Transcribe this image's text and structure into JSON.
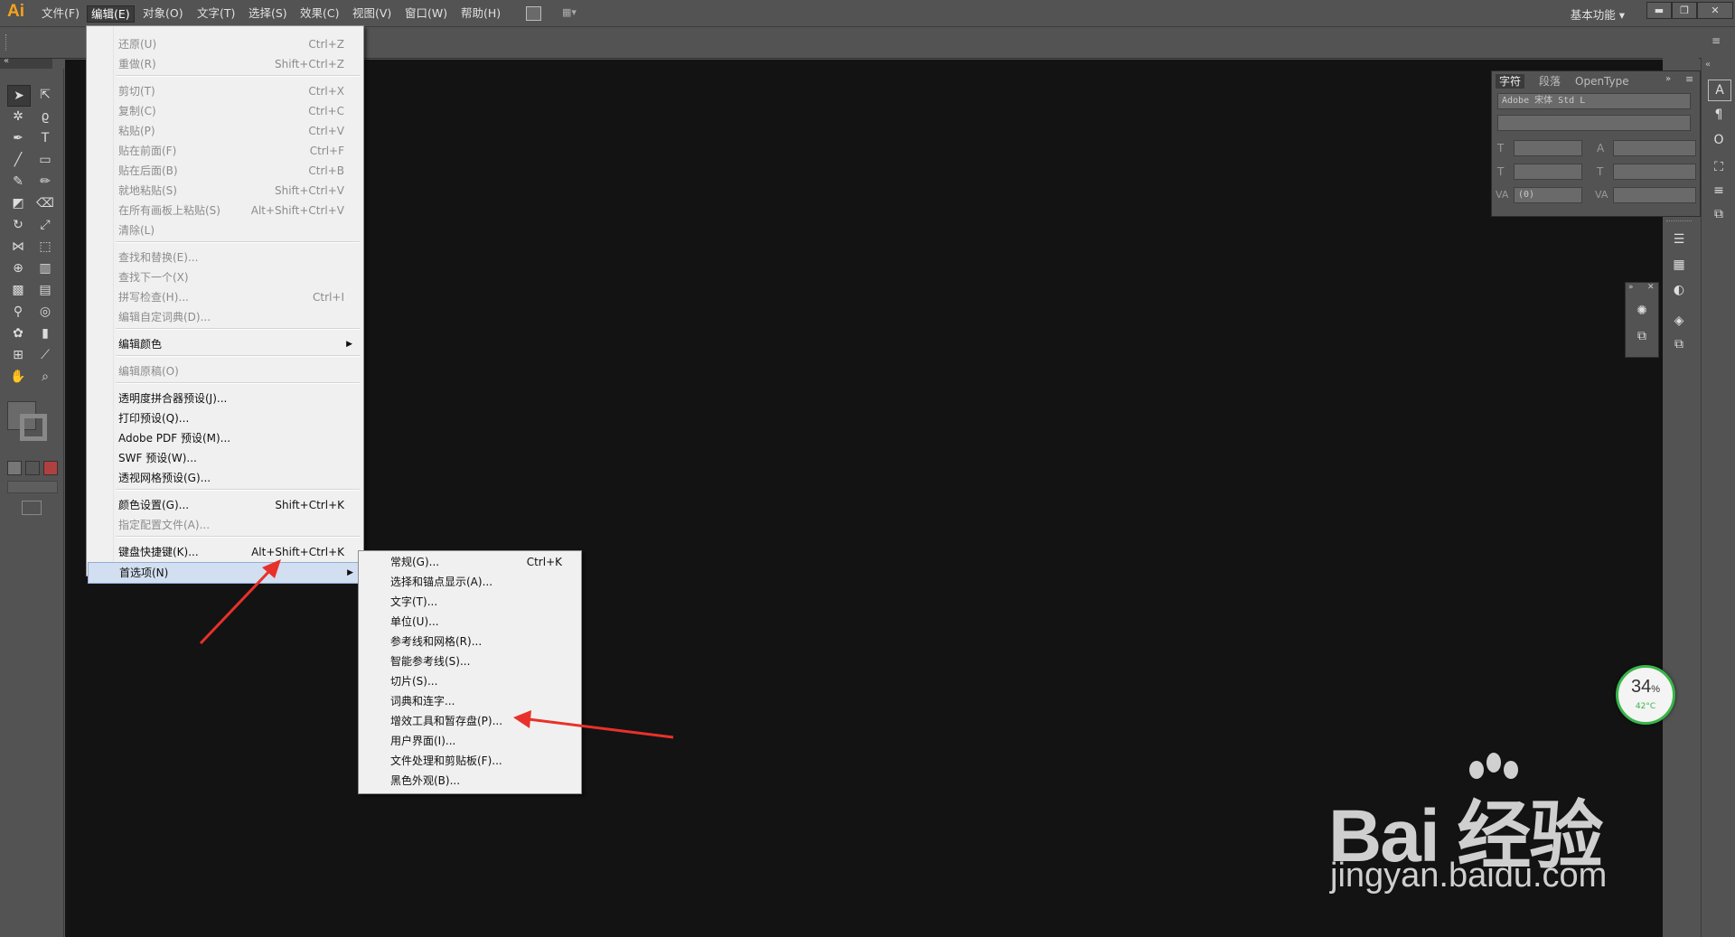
{
  "app": {
    "logo": "Ai",
    "workspace": "基本功能"
  },
  "menubar": {
    "items": [
      "文件(F)",
      "编辑(E)",
      "对象(O)",
      "文字(T)",
      "选择(S)",
      "效果(C)",
      "视图(V)",
      "窗口(W)",
      "帮助(H)"
    ]
  },
  "edit_menu": {
    "items": [
      {
        "label": "还原(U)",
        "shortcut": "Ctrl+Z",
        "enabled": false
      },
      {
        "label": "重做(R)",
        "shortcut": "Shift+Ctrl+Z",
        "enabled": false
      },
      {
        "label": "剪切(T)",
        "shortcut": "Ctrl+X",
        "enabled": false
      },
      {
        "label": "复制(C)",
        "shortcut": "Ctrl+C",
        "enabled": false
      },
      {
        "label": "粘贴(P)",
        "shortcut": "Ctrl+V",
        "enabled": false
      },
      {
        "label": "贴在前面(F)",
        "shortcut": "Ctrl+F",
        "enabled": false
      },
      {
        "label": "贴在后面(B)",
        "shortcut": "Ctrl+B",
        "enabled": false
      },
      {
        "label": "就地粘贴(S)",
        "shortcut": "Shift+Ctrl+V",
        "enabled": false
      },
      {
        "label": "在所有画板上粘贴(S)",
        "shortcut": "Alt+Shift+Ctrl+V",
        "enabled": false
      },
      {
        "label": "清除(L)",
        "shortcut": "",
        "enabled": false
      },
      {
        "label": "查找和替换(E)...",
        "shortcut": "",
        "enabled": false
      },
      {
        "label": "查找下一个(X)",
        "shortcut": "",
        "enabled": false
      },
      {
        "label": "拼写检查(H)...",
        "shortcut": "Ctrl+I",
        "enabled": false
      },
      {
        "label": "编辑自定词典(D)...",
        "shortcut": "",
        "enabled": false
      },
      {
        "label": "编辑颜色",
        "shortcut": "",
        "enabled": true
      },
      {
        "label": "编辑原稿(O)",
        "shortcut": "",
        "enabled": false
      },
      {
        "label": "透明度拼合器预设(J)...",
        "shortcut": "",
        "enabled": true
      },
      {
        "label": "打印预设(Q)...",
        "shortcut": "",
        "enabled": true
      },
      {
        "label": "Adobe PDF 预设(M)...",
        "shortcut": "",
        "enabled": true
      },
      {
        "label": "SWF 预设(W)...",
        "shortcut": "",
        "enabled": true
      },
      {
        "label": "透视网格预设(G)...",
        "shortcut": "",
        "enabled": true
      },
      {
        "label": "颜色设置(G)...",
        "shortcut": "Shift+Ctrl+K",
        "enabled": true
      },
      {
        "label": "指定配置文件(A)...",
        "shortcut": "",
        "enabled": false
      },
      {
        "label": "键盘快捷键(K)...",
        "shortcut": "Alt+Shift+Ctrl+K",
        "enabled": true
      },
      {
        "label": "首选项(N)",
        "shortcut": "",
        "enabled": true
      }
    ]
  },
  "pref_submenu": {
    "items": [
      {
        "label": "常规(G)...",
        "shortcut": "Ctrl+K"
      },
      {
        "label": "选择和锚点显示(A)...",
        "shortcut": ""
      },
      {
        "label": "文字(T)...",
        "shortcut": ""
      },
      {
        "label": "单位(U)...",
        "shortcut": ""
      },
      {
        "label": "参考线和网格(R)...",
        "shortcut": ""
      },
      {
        "label": "智能参考线(S)...",
        "shortcut": ""
      },
      {
        "label": "切片(S)...",
        "shortcut": ""
      },
      {
        "label": "词典和连字...",
        "shortcut": ""
      },
      {
        "label": "增效工具和暂存盘(P)...",
        "shortcut": ""
      },
      {
        "label": "用户界面(I)...",
        "shortcut": ""
      },
      {
        "label": "文件处理和剪贴板(F)...",
        "shortcut": ""
      },
      {
        "label": "黑色外观(B)...",
        "shortcut": ""
      }
    ]
  },
  "char_panel": {
    "tabs": [
      "字符",
      "段落",
      "OpenType"
    ],
    "font": "Adobe 宋体 Std L",
    "tracking": "(0)"
  },
  "perf_widget": {
    "percent": "34",
    "unit": "%",
    "temp": "42°C"
  },
  "watermark": {
    "brand": "Bai 经验",
    "site": "jingyan.baidu.com"
  },
  "colors": {
    "canvas": "#131313",
    "ui": "#535353",
    "menu_bg": "#f0f0f0",
    "highlight": "#d2dff0",
    "arrow": "#e8312a",
    "logo": "#f7a21b"
  }
}
